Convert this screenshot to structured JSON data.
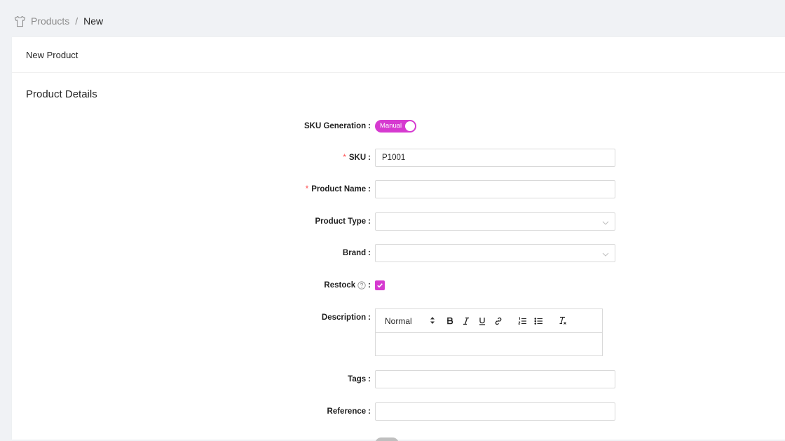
{
  "breadcrumb": {
    "icon": "tshirt-icon",
    "items": [
      "Products",
      "New"
    ],
    "separator": "/"
  },
  "card": {
    "header": "New Product",
    "section_title": "Product Details"
  },
  "form": {
    "sku_generation": {
      "label": "SKU Generation",
      "toggle_text": "Manual",
      "on": true
    },
    "sku": {
      "label": "SKU",
      "required": true,
      "value": "P1001"
    },
    "product_name": {
      "label": "Product Name",
      "required": true,
      "value": ""
    },
    "product_type": {
      "label": "Product Type",
      "value": ""
    },
    "brand": {
      "label": "Brand",
      "value": ""
    },
    "restock": {
      "label": "Restock",
      "checked": true,
      "help_icon": "question-circle-icon"
    },
    "description": {
      "label": "Description",
      "heading_select": "Normal",
      "toolbar_icons": [
        "bold-icon",
        "italic-icon",
        "underline-icon",
        "link-icon",
        "ordered-list-icon",
        "bullet-list-icon",
        "clear-format-icon"
      ],
      "value": ""
    },
    "tags": {
      "label": "Tags",
      "value": ""
    },
    "reference": {
      "label": "Reference",
      "value": ""
    }
  },
  "colors": {
    "accent": "#d63ad0",
    "required": "#ff4d4f",
    "background": "#f0f2f5"
  }
}
